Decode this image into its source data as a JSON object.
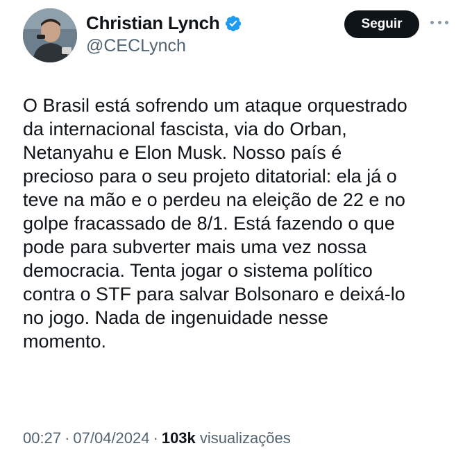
{
  "author": {
    "display_name": "Christian Lynch",
    "handle": "@CECLynch",
    "verified_icon": "verified-badge-icon",
    "avatar_icon": "profile-photo"
  },
  "actions": {
    "follow_label": "Seguir",
    "more_icon": "more-options-icon"
  },
  "tweet": {
    "lines": [
      "O Brasil está sofrendo um ataque orquestrado",
      "da internacional fascista, via do Orban,",
      "Netanyahu e Elon Musk. Nosso país é",
      "precioso para o seu projeto ditatorial: ela já o",
      "teve na mão e o perdeu na eleição de 22 e no",
      "golpe fracassado de 8/1. Está fazendo o que",
      "pode para subverter mais uma vez nossa",
      "democracia. Tenta jogar o sistema político",
      "contra o STF para salvar Bolsonaro e deixá-lo",
      "no jogo. Nada de ingenuidade nesse",
      "momento."
    ]
  },
  "meta": {
    "time": "00:27",
    "separator": "·",
    "date": "07/04/2024",
    "views_count": "103k",
    "views_label": "visualizações"
  },
  "colors": {
    "text": "#0f1419",
    "secondary": "#536471",
    "verified": "#1d9bf0",
    "button_bg": "#0f1419"
  }
}
